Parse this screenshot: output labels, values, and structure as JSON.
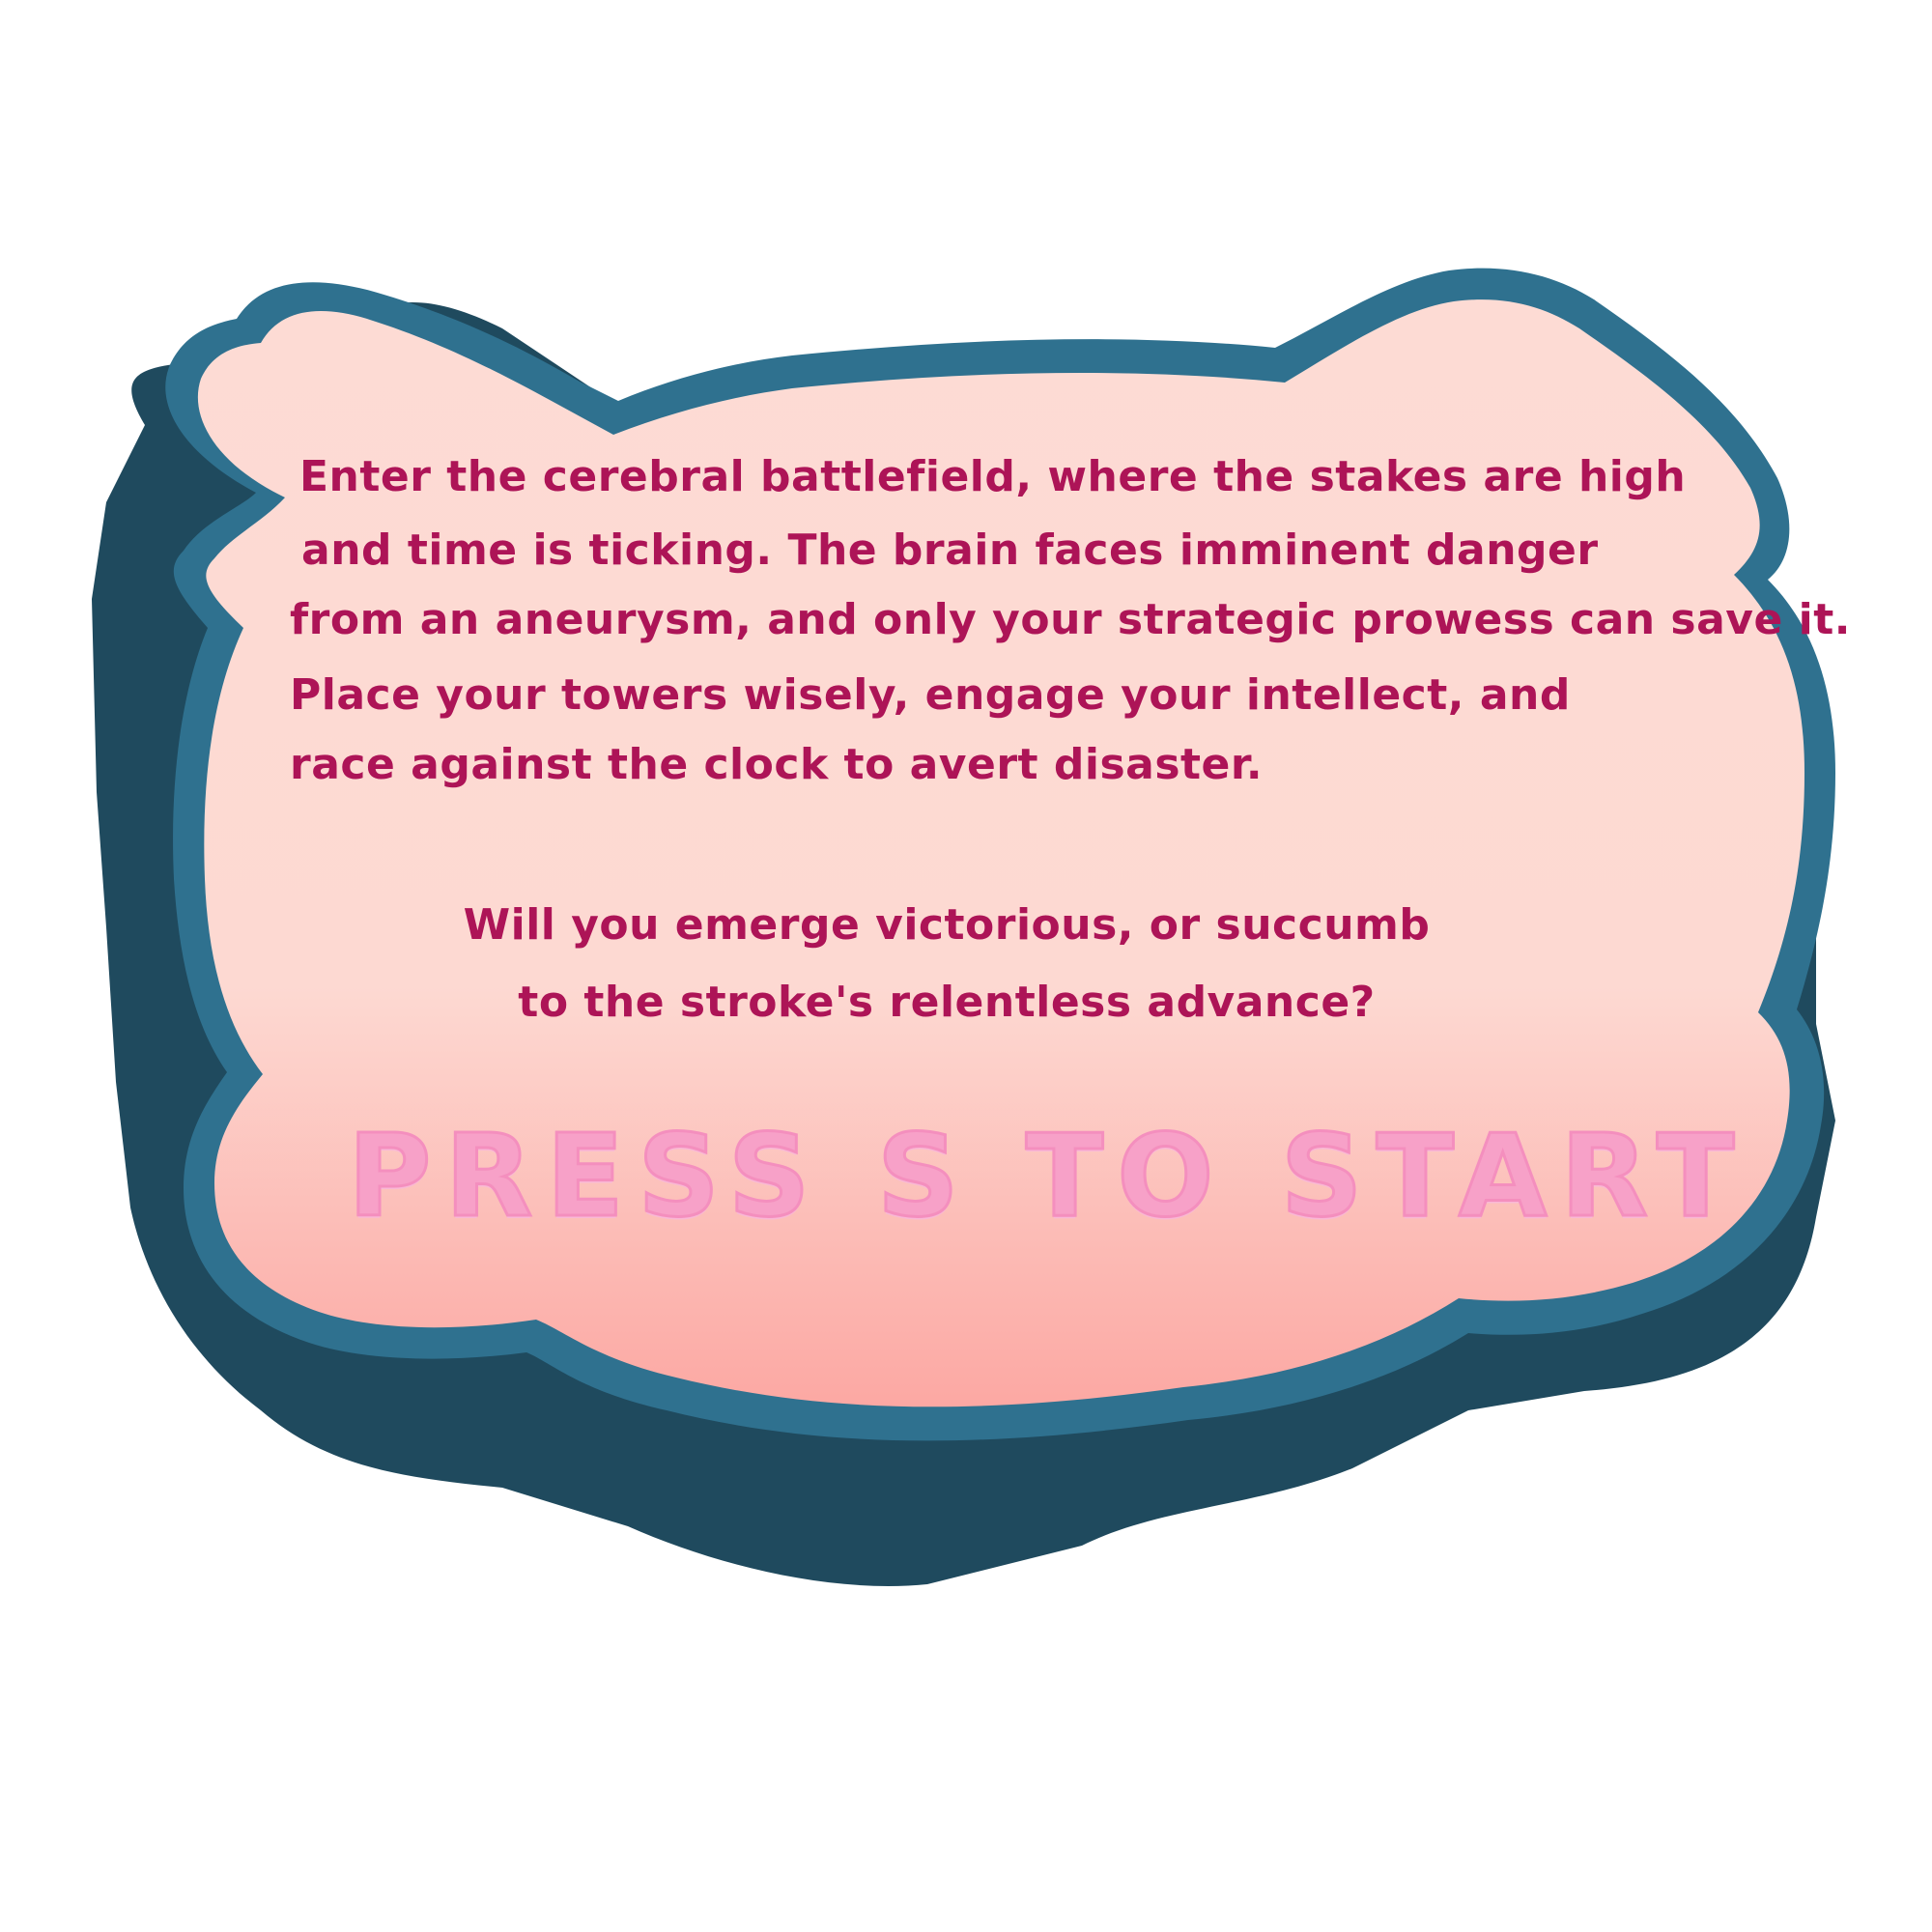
{
  "screen": {
    "name": "intro-screen",
    "colors": {
      "background": "#ffffff",
      "panel_top": "#fddbd4",
      "panel_bottom": "#fca8a3",
      "border": "#2f718f",
      "shadow": "#1f4a5e",
      "story_text": "#ad1457",
      "start_prompt": "#f7a1c8"
    }
  },
  "story": {
    "lines": [
      "Enter the cerebral battlefield, where the stakes are high",
      "and time is ticking. The brain faces imminent danger",
      "from an aneurysm, and only your strategic prowess can save it.",
      "Place your towers wisely, engage your intellect, and",
      "race against the clock to avert disaster."
    ]
  },
  "question": {
    "lines": [
      "Will you emerge victorious, or succumb",
      "to the stroke's relentless advance?"
    ]
  },
  "start_prompt": {
    "text": "PRESS S TO START",
    "key": "S"
  }
}
